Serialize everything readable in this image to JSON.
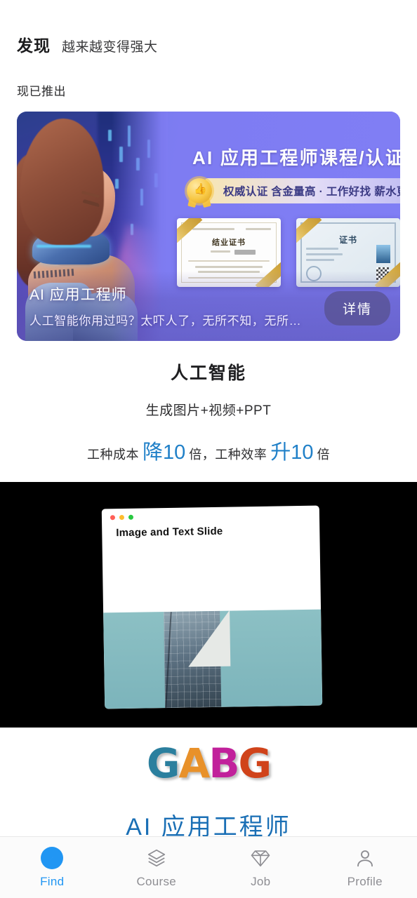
{
  "header": {
    "title": "发现",
    "subtitle": "越来越变得强大"
  },
  "section": {
    "label": "现已推出"
  },
  "banner": {
    "headline": "AI 应用工程师课程/认证",
    "badge_text": "权威认证 含金量高 · 工作好找 薪水更高",
    "badge_icon": "medal-thumbs-up-icon",
    "certificates": [
      {
        "title": "结业证书",
        "name": "completion-certificate"
      },
      {
        "title": "证书",
        "name": "official-certificate"
      }
    ],
    "title": "AI 应用工程师",
    "description": "人工智能你用过吗？太吓人了，无所不知，无所…",
    "button_label": "详情",
    "accent_color": "#7e7cf2"
  },
  "promo": {
    "heading": "人工智能",
    "subheading": "生成图片+视频+PPT",
    "stat_prefix": "工种成本",
    "stat_one": "降10",
    "stat_middle": "倍，工种效率",
    "stat_two": "升10",
    "stat_suffix": "倍",
    "highlight_color": "#2080c8"
  },
  "video": {
    "slide_title": "Image and Text Slide",
    "window_controls": [
      "close-dot",
      "minimize-dot",
      "maximize-dot"
    ],
    "photo_alt": "glass-building-photo"
  },
  "brand": {
    "logo_letters": [
      "G",
      "A",
      "B",
      "G"
    ],
    "logo_colors": [
      "#2b7f9e",
      "#e8912a",
      "#c1219b",
      "#d0431a"
    ],
    "title": "AI 应用工程师",
    "title_color": "#1a6fb5"
  },
  "tabbar": {
    "active_color": "#2196f3",
    "inactive_color": "#8e8e93",
    "items": [
      {
        "label": "Find",
        "icon": "compass-icon",
        "active": true
      },
      {
        "label": "Course",
        "icon": "layers-icon",
        "active": false
      },
      {
        "label": "Job",
        "icon": "diamond-icon",
        "active": false
      },
      {
        "label": "Profile",
        "icon": "person-icon",
        "active": false
      }
    ]
  }
}
